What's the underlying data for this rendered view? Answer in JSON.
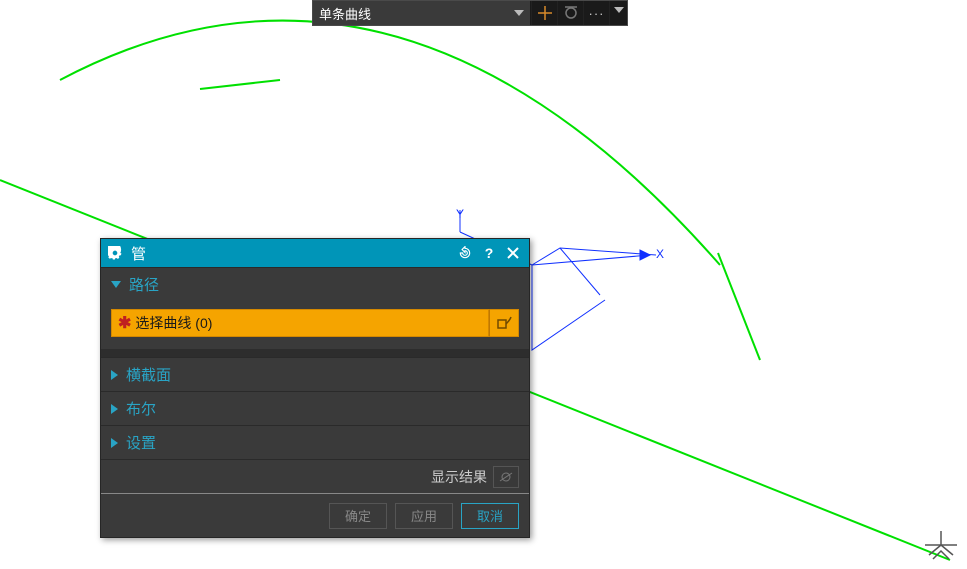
{
  "toolbar": {
    "filter_selected": "单条曲线",
    "ellipsis": "···"
  },
  "dialog": {
    "title": "管",
    "sections": {
      "path": {
        "label": "路径"
      },
      "cross_section": {
        "label": "横截面"
      },
      "boolean": {
        "label": "布尔"
      },
      "settings": {
        "label": "设置"
      }
    },
    "path_prompt": "选择曲线 (0)",
    "show_result_label": "显示结果",
    "buttons": {
      "ok": "确定",
      "apply": "应用",
      "cancel": "取消"
    }
  },
  "viewport": {
    "axis_x": "X",
    "axis_y": "Y"
  }
}
